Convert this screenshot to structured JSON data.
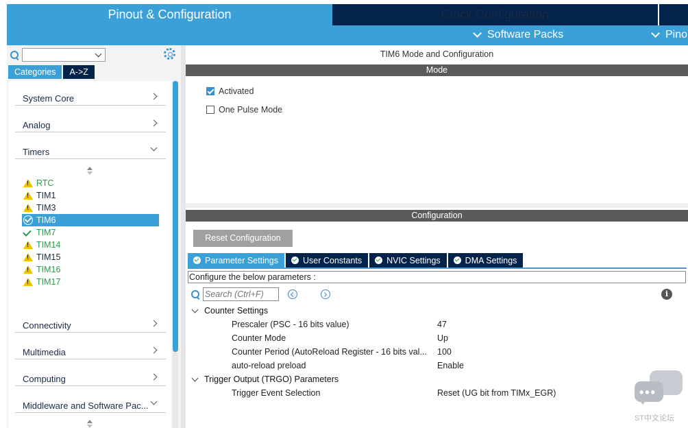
{
  "top_tabs": {
    "pinout": "Pinout & Configuration",
    "clock": "Clock Configuration"
  },
  "sub_menu": {
    "software_packs": "Software Packs",
    "pinout": "Pino"
  },
  "left_panel": {
    "tabs": {
      "categories": "Categories",
      "az": "A->Z"
    },
    "categories": {
      "system_core": "System Core",
      "analog": "Analog",
      "timers": "Timers",
      "connectivity": "Connectivity",
      "multimedia": "Multimedia",
      "computing": "Computing",
      "middleware": "Middleware and Software Pac..."
    },
    "timers": [
      {
        "label": "RTC",
        "status": "warning",
        "color": "green"
      },
      {
        "label": "TIM1",
        "status": "warning",
        "color": "dark"
      },
      {
        "label": "TIM3",
        "status": "warning",
        "color": "dark"
      },
      {
        "label": "TIM6",
        "status": "ok-selected",
        "color": "white"
      },
      {
        "label": "TIM7",
        "status": "ok",
        "color": "green"
      },
      {
        "label": "TIM14",
        "status": "warning",
        "color": "green"
      },
      {
        "label": "TIM15",
        "status": "warning",
        "color": "dark"
      },
      {
        "label": "TIM16",
        "status": "warning",
        "color": "green"
      },
      {
        "label": "TIM17",
        "status": "warning",
        "color": "green"
      }
    ]
  },
  "right_panel": {
    "title": "TIM6 Mode and Configuration",
    "mode_header": "Mode",
    "activated": "Activated",
    "activated_checked": true,
    "one_pulse": "One Pulse Mode",
    "one_pulse_checked": false,
    "config_header": "Configuration",
    "reset_button": "Reset Configuration",
    "tabs": {
      "parameter": "Parameter Settings",
      "user_constants": "User Constants",
      "nvic": "NVIC Settings",
      "dma": "DMA Settings"
    },
    "configure_text": "Configure the below parameters :",
    "search_placeholder": "Search (Ctrl+F)",
    "info_glyph": "i",
    "groups": {
      "counter": {
        "label": "Counter Settings",
        "params": [
          {
            "name": "Prescaler (PSC - 16 bits value)",
            "value": "47"
          },
          {
            "name": "Counter Mode",
            "value": "Up"
          },
          {
            "name": "Counter Period (AutoReload Register - 16 bits val...",
            "value": "100"
          },
          {
            "name": "auto-reload preload",
            "value": "Enable"
          }
        ]
      },
      "trgo": {
        "label": "Trigger Output (TRGO) Parameters",
        "params": [
          {
            "name": "Trigger Event Selection",
            "value": "Reset (UG bit from TIMx_EGR)"
          }
        ]
      }
    }
  },
  "watermark": {
    "text": "ST中文论坛",
    "dots": "•••"
  },
  "colors": {
    "accent_blue": "#3ca0d8",
    "navy": "#03234b",
    "bar_gray": "#5a5a5a",
    "ok_green": "#2e9a4a",
    "warn_yellow": "#f2c100"
  }
}
